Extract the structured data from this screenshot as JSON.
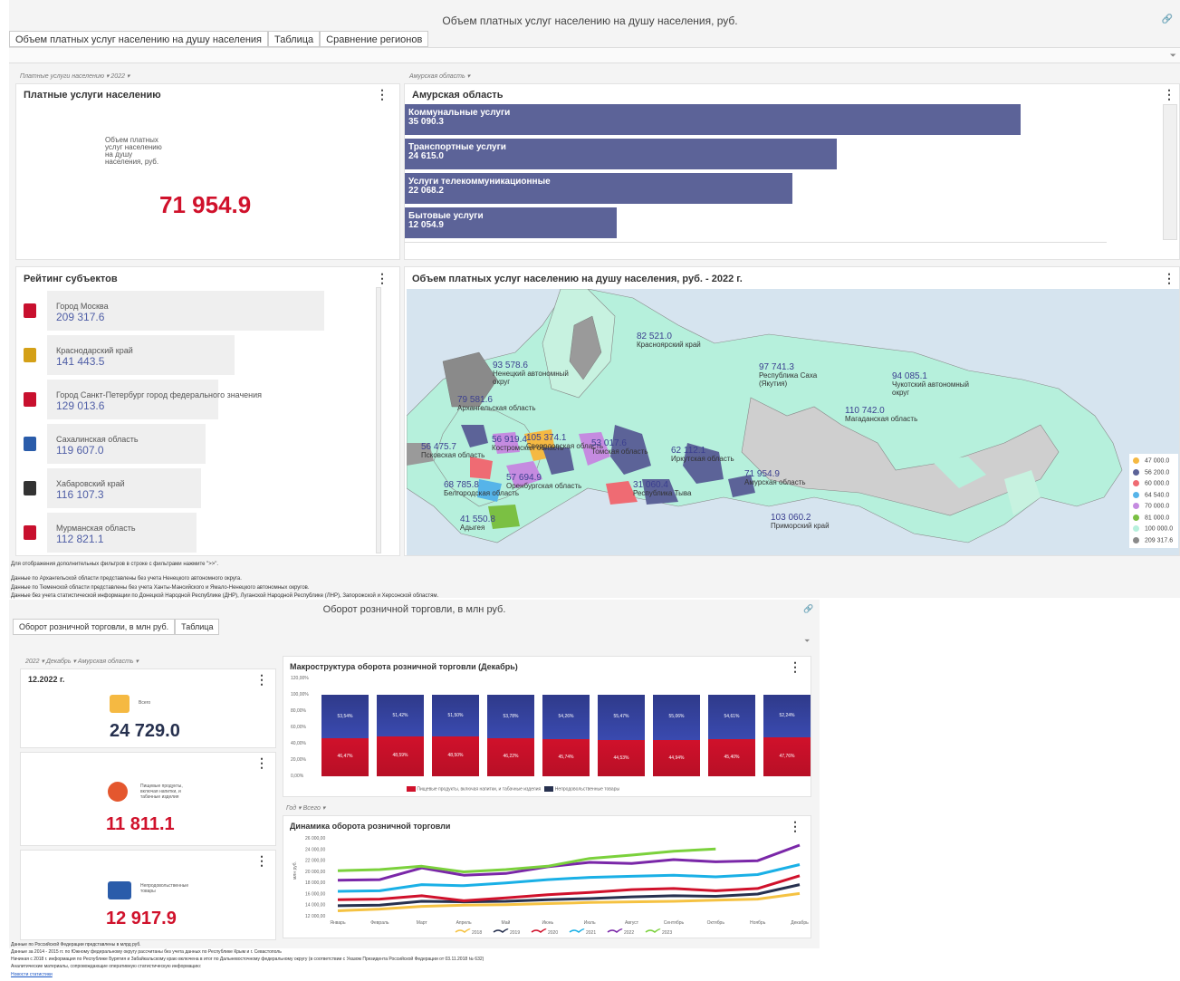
{
  "top": {
    "title": "Объем платных услуг населению на душу населения, руб.",
    "tabs": [
      "Объем платных услуг населению на душу населения",
      "Таблица",
      "Сравнение регионов"
    ],
    "filter_left": "Платные услуги населению ▾  2022 ▾",
    "filter_right": "Амурская область ▾",
    "kpi_panel": {
      "title": "Платные услуги населению",
      "label": "Объем платных услуг населению на душу населения, руб.",
      "value": "71 954.9",
      "value_color": "#d0112b"
    },
    "services_panel": {
      "title": "Амурская область",
      "bars": [
        {
          "name": "Коммунальные услуги",
          "value": "35 090.3",
          "num": 35090.3
        },
        {
          "name": "Транспортные услуги",
          "value": "24 615.0",
          "num": 24615.0
        },
        {
          "name": "Услуги телекоммуникационные",
          "value": "22 068.2",
          "num": 22068.2
        },
        {
          "name": "Бытовые услуги",
          "value": "12 054.9",
          "num": 12054.9
        }
      ]
    },
    "rating_panel": {
      "title": "Рейтинг субъектов",
      "items": [
        {
          "name": "Город Москва",
          "value": "209 317.6",
          "num": 209317.6,
          "emblem": "#c8102e"
        },
        {
          "name": "Краснодарский край",
          "value": "141 443.5",
          "num": 141443.5,
          "emblem": "#d4a017"
        },
        {
          "name": "Город Санкт-Петербург город федерального значения",
          "value": "129 013.6",
          "num": 129013.6,
          "emblem": "#c8102e"
        },
        {
          "name": "Сахалинская область",
          "value": "119 607.0",
          "num": 119607.0,
          "emblem": "#2a5caa"
        },
        {
          "name": "Хабаровский край",
          "value": "116 107.3",
          "num": 116107.3,
          "emblem": "#333333"
        },
        {
          "name": "Мурманская область",
          "value": "112 821.1",
          "num": 112821.1,
          "emblem": "#c8102e"
        }
      ]
    },
    "map_panel": {
      "title": "Объем платных услуг населению на душу населения, руб. - 2022 г.",
      "labels": [
        {
          "value": "82 521.0",
          "name": "Красноярский край"
        },
        {
          "value": "93 578.6",
          "name": "Ненецкий автономный округ"
        },
        {
          "value": "97 741.3",
          "name": "Республика Саха (Якутия)"
        },
        {
          "value": "94 085.1",
          "name": "Чукотский автономный округ"
        },
        {
          "value": "79 581.6",
          "name": "Архангельская область"
        },
        {
          "value": "110 742.0",
          "name": "Магаданская область"
        },
        {
          "value": "56 919.4",
          "name": "Костромская область"
        },
        {
          "value": "105 374.1",
          "name": "Свердловская область"
        },
        {
          "value": "53 017.6",
          "name": "Томская область"
        },
        {
          "value": "56 475.7",
          "name": "Псковская область"
        },
        {
          "value": "62 112.1",
          "name": "Иркутская область"
        },
        {
          "value": "57 694.9",
          "name": "Оренбургская область"
        },
        {
          "value": "71 954.9",
          "name": "Амурская область"
        },
        {
          "value": "68 785.8",
          "name": "Белгородская область"
        },
        {
          "value": "31 060.4",
          "name": "Республика Тыва"
        },
        {
          "value": "103 060.2",
          "name": "Приморский край"
        },
        {
          "value": "41 550.8",
          "name": "Адыгея"
        }
      ],
      "legend": [
        {
          "label": "47 000.0",
          "color": "#f5b942"
        },
        {
          "label": "56 200.0",
          "color": "#5c6398"
        },
        {
          "label": "60 000.0",
          "color": "#ef6b73"
        },
        {
          "label": "64 540.0",
          "color": "#56b4e9"
        },
        {
          "label": "70 000.0",
          "color": "#c58be0"
        },
        {
          "label": "81 000.0",
          "color": "#7bc043"
        },
        {
          "label": "100 000.0",
          "color": "#b6f0dc"
        },
        {
          "label": "209 317.6",
          "color": "#8a8a8a"
        }
      ]
    },
    "notes": [
      "Для отображения дополнительных фильтров в строке с фильтрами нажмите \">>\".",
      "Данные по Архангельской области представлены без учета Ненецкого автономного округа.",
      "Данные по Тюменской области представлены без учета Ханты-Мансийского и Ямало-Ненецкого автономных округов.",
      "Данные без учета статистической информации по Донецкой Народной Республике (ДНР), Луганской Народной Республике (ЛНР), Запорожской и Херсонской областям."
    ]
  },
  "bottom": {
    "title": "Оборот розничной торговли, в млн руб.",
    "tabs": [
      "Оборот розничной торговли, в млн руб.",
      "Таблица"
    ],
    "filter": "2022 ▾  Декабрь ▾  Амурская область ▾",
    "period": "12.2022 г.",
    "kpis": [
      {
        "label": "Всего",
        "value": "24 729.0",
        "color": "#27314f"
      },
      {
        "label": "Пищевые продукты, включая напитки, и табачные изделия",
        "value": "11 811.1",
        "color": "#d0112b"
      },
      {
        "label": "Непродовольственные товары",
        "value": "12 917.9",
        "color": "#d0112b"
      }
    ],
    "structure": {
      "title": "Макроструктура оборота розничной торговли (Декабрь)",
      "yticks": [
        "120,00%",
        "100,00%",
        "80,00%",
        "60,00%",
        "40,00%",
        "20,00%",
        "0,00%"
      ],
      "bars": [
        {
          "top": "53,54%",
          "bottom": "46,47%"
        },
        {
          "top": "51,42%",
          "bottom": "48,59%"
        },
        {
          "top": "51,50%",
          "bottom": "48,50%"
        },
        {
          "top": "53,78%",
          "bottom": "46,22%"
        },
        {
          "top": "54,26%",
          "bottom": "45,74%"
        },
        {
          "top": "55,47%",
          "bottom": "44,53%"
        },
        {
          "top": "55,06%",
          "bottom": "44,94%"
        },
        {
          "top": "54,61%",
          "bottom": "45,40%"
        },
        {
          "top": "52,24%",
          "bottom": "47,76%"
        }
      ],
      "legend": [
        "Пищевые продукты, включая напитки, и табачные изделия",
        "Непродовольственные товары"
      ]
    },
    "dynamics": {
      "filter": "Год ▾  Всего ▾",
      "title": "Динамика оборота розничной торговли",
      "ylabel": "млн руб.",
      "yticks": [
        "26 000,00",
        "24 000,00",
        "22 000,00",
        "20 000,00",
        "18 000,00",
        "16 000,00",
        "14 000,00",
        "12 000,00"
      ],
      "months": [
        "Январь",
        "Февраль",
        "Март",
        "Апрель",
        "Май",
        "Июнь",
        "Июль",
        "Август",
        "Сентябрь",
        "Октябрь",
        "Ноябрь",
        "Декабрь"
      ],
      "series": [
        {
          "name": "2018",
          "color": "#f5c242",
          "values": [
            12900,
            13200,
            13700,
            13900,
            14000,
            14200,
            14400,
            14500,
            14600,
            14800,
            15000,
            16000
          ]
        },
        {
          "name": "2019",
          "color": "#27314f",
          "values": [
            13800,
            13900,
            14600,
            14500,
            14600,
            14900,
            15100,
            15400,
            15600,
            15500,
            15900,
            17600
          ]
        },
        {
          "name": "2020",
          "color": "#d0112b",
          "values": [
            14900,
            15000,
            15600,
            14700,
            15200,
            15800,
            16200,
            16700,
            16900,
            16500,
            16900,
            19200
          ]
        },
        {
          "name": "2021",
          "color": "#1ab0e6",
          "values": [
            16400,
            16500,
            17600,
            17400,
            17900,
            18500,
            18900,
            19100,
            19300,
            19000,
            19400,
            21200
          ]
        },
        {
          "name": "2022",
          "color": "#7a27a8",
          "values": [
            18400,
            18500,
            20600,
            19300,
            19600,
            20800,
            21600,
            21400,
            22100,
            21700,
            21900,
            24700
          ]
        },
        {
          "name": "2023",
          "color": "#7bd13c",
          "values": [
            20100,
            20300,
            20900,
            19900,
            20300,
            20900,
            22300,
            22900,
            23600,
            24000,
            null,
            null
          ]
        }
      ]
    },
    "notes": [
      "Данные по Российской Федерации представлены в млрд руб.",
      "Данные за 2014 - 2015 гг. по Южному федеральному округу рассчитаны без учета данных по Республике Крым и г. Севастополь",
      "Начиная с 2018 г. информация по Республике Бурятия и Забайкальскому краю включена в итог по Дальневосточному федеральному округу (в соответствии с Указом Президента Российской Федерации от 03.11.2018 № 632)",
      "Аналитические материалы, сопровождающие оперативную статистическую информацию:"
    ],
    "link": "Новости статистики"
  }
}
